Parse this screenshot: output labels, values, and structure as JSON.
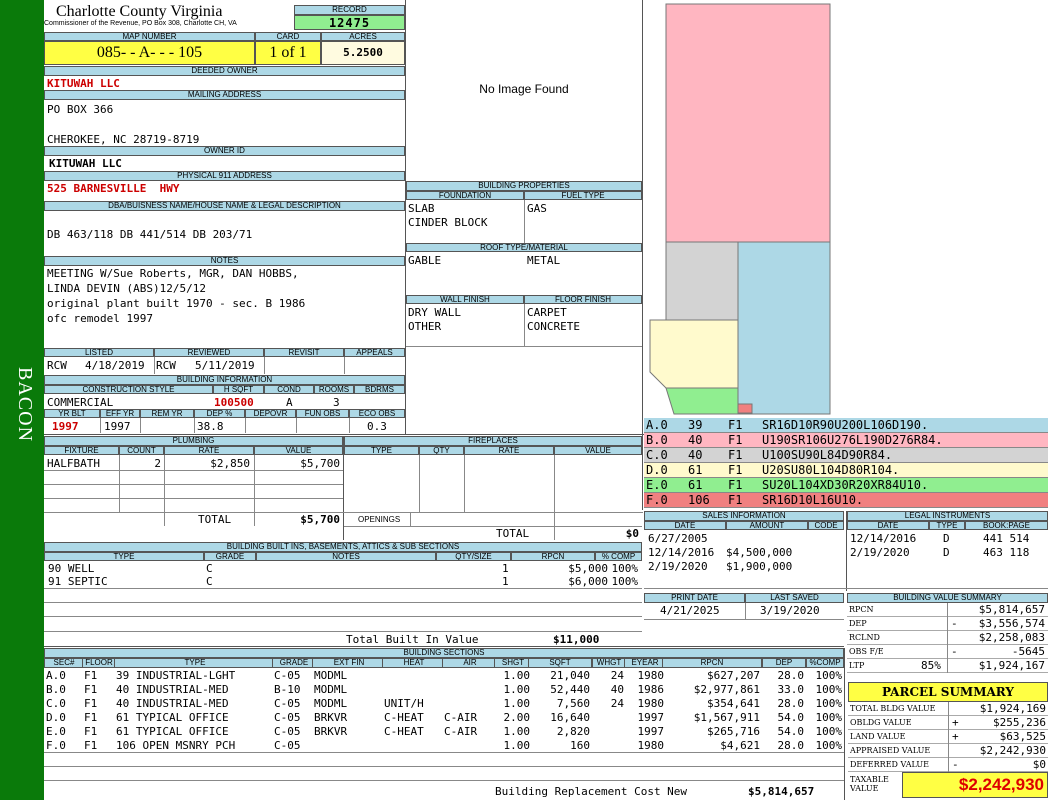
{
  "side_label": "BACON",
  "county": "Charlotte County Virginia",
  "commissioner": "Commissioner of the Revenue, PO Box 308, Charlotte CH, VA",
  "labels": {
    "record": "RECORD",
    "map_number": "MAP NUMBER",
    "card": "CARD",
    "acres": "ACRES",
    "deeded_owner": "DEEDED OWNER",
    "mailing_address": "MAILING ADDRESS",
    "owner_id": "OWNER ID",
    "physical_address": "PHYSICAL 911 ADDRESS",
    "dba": "DBA/BUISNESS NAME/HOUSE NAME & LEGAL DESCRIPTION",
    "notes": "NOTES",
    "listed": "LISTED",
    "reviewed": "REVIEWED",
    "revisit": "REVISIT",
    "appeals": "APPEALS",
    "building_info": "BUILDING INFORMATION",
    "construction_style": "CONSTRUCTION STYLE",
    "hsqft": "H SQFT",
    "cond": "COND",
    "rooms": "ROOMS",
    "bdrms": "BDRMS",
    "yr_blt": "YR BLT",
    "eff_yr": "EFF YR",
    "rem_yr": "REM YR",
    "dep_pct": "DEP %",
    "depovr": "DEPOVR",
    "fun_obs": "FUN OBS",
    "eco_obs": "ECO OBS",
    "building_properties": "BUILDING PROPERTIES",
    "foundation": "FOUNDATION",
    "fuel_type": "FUEL TYPE",
    "roof": "ROOF TYPE/MATERIAL",
    "wall_finish": "WALL FINISH",
    "floor_finish": "FLOOR FINISH",
    "plumbing": "PLUMBING",
    "fixture": "FIXTURE",
    "count": "COUNT",
    "rate": "RATE",
    "value": "VALUE",
    "fireplaces": "FIREPLACES",
    "type": "TYPE",
    "qty": "QTY",
    "openings": "OPENINGS",
    "total": "TOTAL",
    "builtins": "BUILDING BUILT INS, BASEMENTS, ATTICS & SUB SECTIONS",
    "grade": "GRADE",
    "notes_col": "NOTES",
    "qty_size": "QTY/SIZE",
    "rpcn": "RPCN",
    "pct_comp": "% COMP",
    "total_built_in": "Total Built In Value",
    "sales_info": "SALES INFORMATION",
    "date": "DATE",
    "amount": "AMOUNT",
    "code": "CODE",
    "legal_instruments": "LEGAL INSTRUMENTS",
    "bookpage": "BOOK:PAGE",
    "print_date": "PRINT DATE",
    "last_saved": "LAST SAVED",
    "building_value_summary": "BUILDING VALUE SUMMARY",
    "building_sections": "BUILDING SECTIONS",
    "replacement_cost": "Building Replacement Cost New"
  },
  "record": "12475",
  "map_number": "085- - A- - - 105",
  "card": "1 of 1",
  "acres": "5.2500",
  "deeded_owner": "KITUWAH LLC",
  "mailing_address": [
    "PO BOX 366",
    "",
    "CHEROKEE, NC 28719-8719"
  ],
  "owner_id": "KITUWAH LLC",
  "physical_address": "525 BARNESVILLE  HWY",
  "dba": "DB 463/118 DB 441/514 DB 203/71",
  "notes": [
    "MEETING W/Sue Roberts, MGR, DAN HOBBS,",
    "LINDA DEVIN (ABS)12/5/12",
    "original plant built 1970 - sec. B 1986",
    "ofc remodel 1997"
  ],
  "listed": {
    "by": "RCW",
    "date": "4/18/2019"
  },
  "reviewed": {
    "by": "RCW",
    "date": "5/11/2019"
  },
  "building_info": {
    "style": "COMMERCIAL",
    "hsqft": "100500",
    "cond": "A",
    "rooms": "3",
    "bdrms": "",
    "yr_blt": "1997",
    "eff_yr": "1997",
    "rem_yr": "",
    "dep_pct": "38.8",
    "depovr": "",
    "fun_obs": "",
    "eco_obs": "0.3"
  },
  "no_image": "No Image Found",
  "properties": {
    "foundation": [
      "SLAB",
      "CINDER BLOCK"
    ],
    "fuel": [
      "GAS"
    ],
    "roof": [
      "GABLE",
      "METAL"
    ],
    "wall": [
      "DRY WALL",
      "OTHER"
    ],
    "floor": [
      "CARPET",
      "CONCRETE"
    ]
  },
  "plumbing": {
    "rows": [
      {
        "fixture": "HALFBATH",
        "count": "2",
        "rate": "$2,850",
        "value": "$5,700"
      }
    ],
    "total": "$5,700"
  },
  "fireplaces": {
    "total": "$0"
  },
  "builtins": {
    "rows": [
      {
        "type": "90 WELL",
        "grade": "C",
        "qty": "1",
        "rpcn": "$5,000",
        "pct": "100%"
      },
      {
        "type": "91 SEPTIC",
        "grade": "C",
        "qty": "1",
        "rpcn": "$6,000",
        "pct": "100%"
      }
    ],
    "total": "$11,000"
  },
  "sketch_legend": [
    {
      "code": "A.0",
      "n": "39",
      "fl": "F1",
      "path": "SR16D10R90U200L106D190.",
      "color": "#add8e6"
    },
    {
      "code": "B.0",
      "n": "40",
      "fl": "F1",
      "path": "U190SR106U276L190D276R84.",
      "color": "#ffb6c1"
    },
    {
      "code": "C.0",
      "n": "40",
      "fl": "F1",
      "path": "U100SU90L84D90R84.",
      "color": "#d3d3d3"
    },
    {
      "code": "D.0",
      "n": "61",
      "fl": "F1",
      "path": "U20SU80L104D80R104.",
      "color": "#fffacd"
    },
    {
      "code": "E.0",
      "n": "61",
      "fl": "F1",
      "path": "SU20L104XD30R20XR84U10.",
      "color": "#90ee90"
    },
    {
      "code": "F.0",
      "n": "106",
      "fl": "F1",
      "path": "SR16D10L16U10.",
      "color": "#f08080"
    }
  ],
  "sales": [
    {
      "date": "6/27/2005",
      "amount": "",
      "code": ""
    },
    {
      "date": "12/14/2016",
      "amount": "$4,500,000",
      "code": ""
    },
    {
      "date": "2/19/2020",
      "amount": "$1,900,000",
      "code": ""
    }
  ],
  "legal": [
    {
      "date": "12/14/2016",
      "type": "D",
      "bp": "441 514"
    },
    {
      "date": "2/19/2020",
      "type": "D",
      "bp": "463 118"
    }
  ],
  "print_date": "4/21/2025",
  "last_saved": "3/19/2020",
  "value_summary": [
    {
      "label": "RPCN",
      "sign": "",
      "pct": "",
      "value": "$5,814,657"
    },
    {
      "label": "DEP",
      "sign": "-",
      "pct": "",
      "value": "$3,556,574"
    },
    {
      "label": "RCLND",
      "sign": "",
      "pct": "",
      "value": "$2,258,083"
    },
    {
      "label": "OBS F/E",
      "sign": "-",
      "pct": "",
      "value": "-5645"
    },
    {
      "label": "LTP",
      "sign": "",
      "pct": "85%",
      "value": "$1,924,167"
    }
  ],
  "parcel_summary": {
    "title": "PARCEL SUMMARY",
    "rows": [
      {
        "label": "TOTAL BLDG VALUE",
        "sign": "",
        "value": "$1,924,169"
      },
      {
        "label": "OBLDG VALUE",
        "sign": "+",
        "value": "$255,236"
      },
      {
        "label": "LAND VALUE",
        "sign": "+",
        "value": "$63,525"
      },
      {
        "label": "APPRAISED VALUE",
        "sign": "",
        "value": "$2,242,930"
      },
      {
        "label": "DEFERRED VALUE",
        "sign": "-",
        "value": "$0"
      }
    ],
    "taxable_label": "TAXABLE VALUE",
    "taxable_value": "$2,242,930"
  },
  "sections": {
    "headers": [
      "SEC#",
      "FLOOR",
      "TYPE",
      "GRADE",
      "EXT FIN",
      "HEAT",
      "AIR",
      "SHGT",
      "SQFT",
      "WHGT",
      "EYEAR",
      "RPCN",
      "DEP",
      "%COMP"
    ],
    "rows": [
      [
        "A.0",
        "F1",
        "39 INDUSTRIAL-LGHT",
        "C-05",
        "MODML",
        "",
        "",
        "1.00",
        "21,040",
        "24",
        "1980",
        "$627,207",
        "28.0",
        "100%"
      ],
      [
        "B.0",
        "F1",
        "40 INDUSTRIAL-MED",
        "B-10",
        "MODML",
        "",
        "",
        "1.00",
        "52,440",
        "40",
        "1986",
        "$2,977,861",
        "33.0",
        "100%"
      ],
      [
        "C.0",
        "F1",
        "40 INDUSTRIAL-MED",
        "C-05",
        "MODML",
        "UNIT/H",
        "",
        "1.00",
        "7,560",
        "24",
        "1980",
        "$354,641",
        "28.0",
        "100%"
      ],
      [
        "D.0",
        "F1",
        "61 TYPICAL OFFICE",
        "C-05",
        "BRKVR",
        "C-HEAT",
        "C-AIR",
        "2.00",
        "16,640",
        "",
        "1997",
        "$1,567,911",
        "54.0",
        "100%"
      ],
      [
        "E.0",
        "F1",
        "61 TYPICAL OFFICE",
        "C-05",
        "BRKVR",
        "C-HEAT",
        "C-AIR",
        "1.00",
        "2,820",
        "",
        "1997",
        "$265,716",
        "54.0",
        "100%"
      ],
      [
        "F.0",
        "F1",
        "106 OPEN MSNRY PCH",
        "C-05",
        "",
        "",
        "",
        "1.00",
        "160",
        "",
        "1980",
        "$4,621",
        "28.0",
        "100%"
      ]
    ],
    "replacement_cost": "$5,814,657"
  }
}
